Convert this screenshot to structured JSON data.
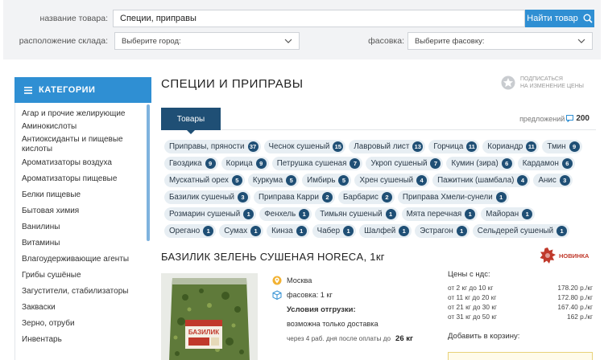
{
  "search": {
    "name_label": "название товара:",
    "name_value": "Специи, приправы",
    "button_label": "Найти товар",
    "warehouse_label": "расположение склада:",
    "city_placeholder": "Выберите город:",
    "pack_label": "фасовка:",
    "pack_placeholder": "Выберите фасовку:"
  },
  "sidebar": {
    "header": "КАТЕГОРИИ",
    "items": [
      "Агар и прочие желирующие",
      "Аминокислоты",
      "Антиоксиданты и пищевые кислоты",
      "Ароматизаторы воздуха",
      "Ароматизаторы пищевые",
      "Белки пищевые",
      "Бытовая химия",
      "Ванилины",
      "Витамины",
      "Влагоудерживающие агенты",
      "Грибы сушёные",
      "Загустители, стабилизаторы",
      "Закваски",
      "Зерно, отруби",
      "Инвентарь"
    ]
  },
  "main": {
    "title": "СПЕЦИИ И ПРИПРАВЫ",
    "subscribe_line1": "ПОДПИСАТЬСЯ",
    "subscribe_line2": "НА ИЗМЕНЕНИЕ ЦЕНЫ",
    "tab_label": "Товары",
    "offers_label": "предложений",
    "offers_count": "200"
  },
  "tags": [
    [
      {
        "label": "Приправы, пряности",
        "count": "37"
      },
      {
        "label": "Чеснок сушеный",
        "count": "15"
      },
      {
        "label": "Лавровый лист",
        "count": "13"
      },
      {
        "label": "Горчица",
        "count": "11"
      },
      {
        "label": "Кориандр",
        "count": "11"
      },
      {
        "label": "Тмин",
        "count": "9"
      }
    ],
    [
      {
        "label": "Гвоздика",
        "count": "9"
      },
      {
        "label": "Корица",
        "count": "9"
      },
      {
        "label": "Петрушка сушеная",
        "count": "7"
      },
      {
        "label": "Укроп сушеный",
        "count": "7"
      },
      {
        "label": "Кумин (зира)",
        "count": "6"
      },
      {
        "label": "Кардамон",
        "count": "6"
      }
    ],
    [
      {
        "label": "Мускатный орех",
        "count": "5"
      },
      {
        "label": "Куркума",
        "count": "5"
      },
      {
        "label": "Имбирь",
        "count": "5"
      },
      {
        "label": "Хрен сушеный",
        "count": "4"
      },
      {
        "label": "Пажитник (шамбала)",
        "count": "4"
      },
      {
        "label": "Анис",
        "count": "3"
      }
    ],
    [
      {
        "label": "Базилик сушеный",
        "count": "3"
      },
      {
        "label": "Приправа Карри",
        "count": "2"
      },
      {
        "label": "Барбарис",
        "count": "2"
      },
      {
        "label": "Приправа Хмели-сунели",
        "count": "1"
      }
    ],
    [
      {
        "label": "Розмарин сушеный",
        "count": "1"
      },
      {
        "label": "Фенхель",
        "count": "1"
      },
      {
        "label": "Тимьян сушеный",
        "count": "1"
      },
      {
        "label": "Мята перечная",
        "count": "1"
      },
      {
        "label": "Майоран",
        "count": "1"
      }
    ],
    [
      {
        "label": "Орегано",
        "count": "1"
      },
      {
        "label": "Сумах",
        "count": "1"
      },
      {
        "label": "Кинза",
        "count": "1"
      },
      {
        "label": "Чабер",
        "count": "1"
      },
      {
        "label": "Шалфей",
        "count": "1"
      },
      {
        "label": "Эстрагон",
        "count": "1"
      },
      {
        "label": "Сельдерей сушеный",
        "count": "1"
      }
    ]
  ],
  "product": {
    "title": "БАЗИЛИК ЗЕЛЕНЬ СУШЕНАЯ HORECA, 1кг",
    "badge": "НОВИНКА",
    "package_label": "БАЗИЛИК",
    "city": "Москва",
    "pack": "фасовка: 1 кг",
    "shipping_title": "Условия отгрузки:",
    "shipping_option": "возможна только доставка",
    "shipping_time": "через 4 раб. дня после оплаты до",
    "shipping_weight": "26 кг",
    "prices_title": "Цены с ндс:",
    "prices": [
      {
        "range": "от 2 кг до 10 кг",
        "price": "178.20 р./кг"
      },
      {
        "range": "от 11 кг до 20 кг",
        "price": "172.80 р./кг"
      },
      {
        "range": "от 21 кг до 30 кг",
        "price": "167.40 р./кг"
      },
      {
        "range": "от 31 кг до 50 кг",
        "price": "162 р./кг"
      }
    ],
    "cart_label": "Добавить в корзину:"
  },
  "colors": {
    "accent": "#2f8fd3",
    "dark_tab": "#1f4f75",
    "tag_bg": "#e7eef3",
    "new_red": "#c0392b"
  }
}
